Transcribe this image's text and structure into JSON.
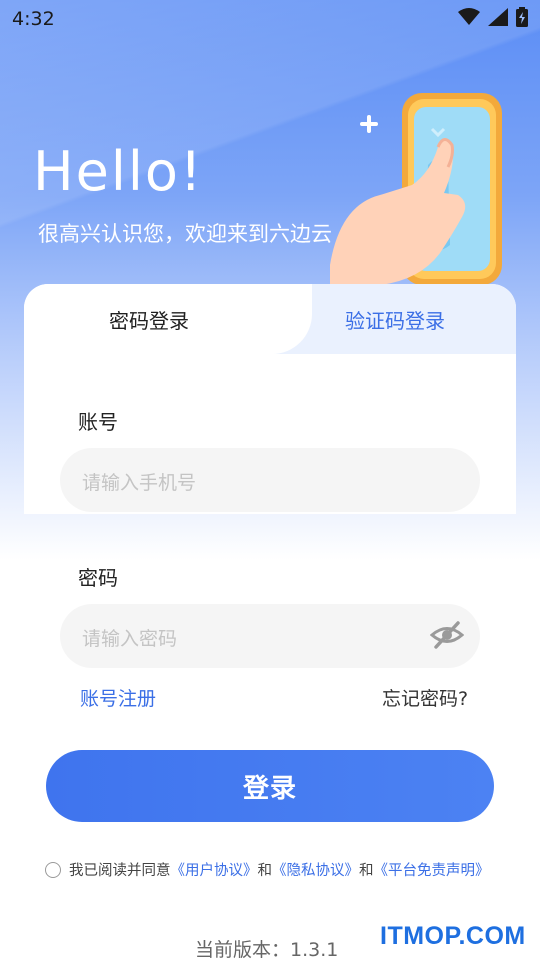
{
  "status_bar": {
    "time": "4:32"
  },
  "header": {
    "greeting": "Hello!",
    "welcome": "很高兴认识您，欢迎来到六边云"
  },
  "tabs": [
    {
      "label": "密码登录",
      "active": true
    },
    {
      "label": "验证码登录",
      "active": false
    }
  ],
  "form": {
    "account_label": "账号",
    "account_placeholder": "请输入手机号",
    "password_label": "密码",
    "password_placeholder": "请输入密码"
  },
  "links": {
    "register": "账号注册",
    "forgot": "忘记密码?"
  },
  "login_button": "登录",
  "agreement": {
    "prefix": "我已阅读并同意",
    "user_agreement": "《用户协议》",
    "and1": "和",
    "privacy": "《隐私协议》",
    "and2": "和",
    "disclaimer": "《平台免责声明》",
    "checked": false
  },
  "version": "当前版本：1.3.1",
  "watermark": "ITMOP.COM",
  "colors": {
    "accent": "#3b6fe6",
    "button": "#4079ef",
    "header_gradient_top": "#5b8df5"
  },
  "icons": {
    "wifi": "wifi-icon",
    "signal": "signal-icon",
    "battery": "battery-icon",
    "password_visibility": "eye-off-icon"
  }
}
